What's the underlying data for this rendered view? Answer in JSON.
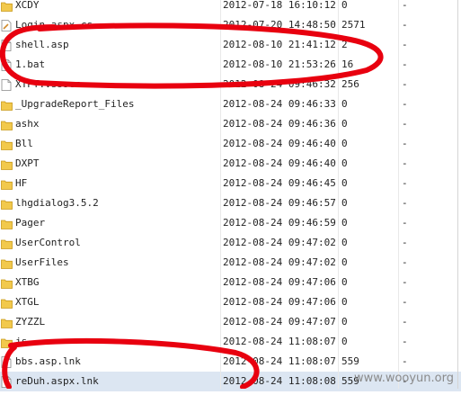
{
  "files": [
    {
      "name": "XCDY",
      "date": "2012-07-18 16:10:12",
      "size": "0",
      "dash": "-",
      "icon": "folder-icon"
    },
    {
      "name": "Login.aspx.cs",
      "date": "2012-07-20 14:48:50",
      "size": "2571",
      "dash": "-",
      "icon": "cs-file-icon"
    },
    {
      "name": "shell.asp",
      "date": "2012-08-10 21:41:12",
      "size": "2",
      "dash": "-",
      "icon": "file-icon"
    },
    {
      "name": "1.bat",
      "date": "2012-08-10 21:53:26",
      "size": "16",
      "dash": "-",
      "icon": "file-icon"
    },
    {
      "name": "XTPT.vssscc",
      "date": "2012-08-24 09:46:32",
      "size": "256",
      "dash": "-",
      "icon": "file-icon"
    },
    {
      "name": "_UpgradeReport_Files",
      "date": "2012-08-24 09:46:33",
      "size": "0",
      "dash": "-",
      "icon": "folder-icon"
    },
    {
      "name": "ashx",
      "date": "2012-08-24 09:46:36",
      "size": "0",
      "dash": "-",
      "icon": "folder-icon"
    },
    {
      "name": "Bll",
      "date": "2012-08-24 09:46:40",
      "size": "0",
      "dash": "-",
      "icon": "folder-icon"
    },
    {
      "name": "DXPT",
      "date": "2012-08-24 09:46:40",
      "size": "0",
      "dash": "-",
      "icon": "folder-icon"
    },
    {
      "name": "HF",
      "date": "2012-08-24 09:46:45",
      "size": "0",
      "dash": "-",
      "icon": "folder-icon"
    },
    {
      "name": "lhgdialog3.5.2",
      "date": "2012-08-24 09:46:57",
      "size": "0",
      "dash": "-",
      "icon": "folder-icon"
    },
    {
      "name": "Pager",
      "date": "2012-08-24 09:46:59",
      "size": "0",
      "dash": "-",
      "icon": "folder-icon"
    },
    {
      "name": "UserControl",
      "date": "2012-08-24 09:47:02",
      "size": "0",
      "dash": "-",
      "icon": "folder-icon"
    },
    {
      "name": "UserFiles",
      "date": "2012-08-24 09:47:02",
      "size": "0",
      "dash": "-",
      "icon": "folder-icon"
    },
    {
      "name": "XTBG",
      "date": "2012-08-24 09:47:06",
      "size": "0",
      "dash": "-",
      "icon": "folder-icon"
    },
    {
      "name": "XTGL",
      "date": "2012-08-24 09:47:06",
      "size": "0",
      "dash": "-",
      "icon": "folder-icon"
    },
    {
      "name": "ZYZZL",
      "date": "2012-08-24 09:47:07",
      "size": "0",
      "dash": "-",
      "icon": "folder-icon"
    },
    {
      "name": "js",
      "date": "2012-08-24 11:08:07",
      "size": "0",
      "dash": "-",
      "icon": "folder-icon"
    },
    {
      "name": "bbs.asp.lnk",
      "date": "2012-08-24 11:08:07",
      "size": "559",
      "dash": "-",
      "icon": "file-icon"
    },
    {
      "name": "reDuh.aspx.lnk",
      "date": "2012-08-24 11:08:08",
      "size": "559",
      "dash": "-",
      "icon": "file-icon",
      "selected": true
    }
  ],
  "watermark": "www.wooyun.org",
  "colors": {
    "annotation": "#e8000f",
    "selection": "#dce6f2",
    "folder": "#f2c94c",
    "folder_edge": "#c99a1c"
  }
}
